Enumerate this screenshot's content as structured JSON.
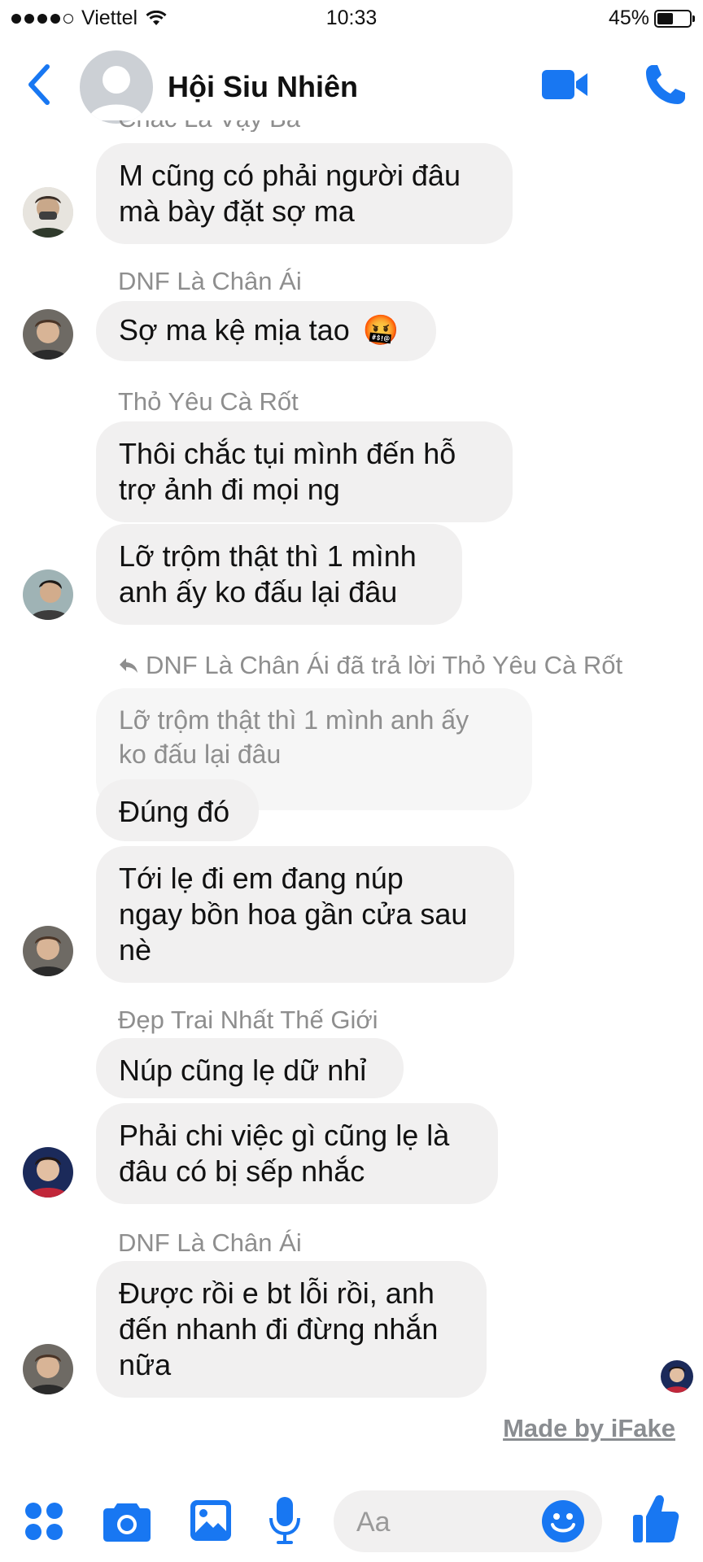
{
  "status": {
    "carrier": "Viettel",
    "time": "10:33",
    "battery": "45%",
    "battery_level": 0.45
  },
  "header": {
    "title": "Hội Siu Nhiên"
  },
  "conversation": {
    "cut_off_name": "Chắc Là Vậy Ba",
    "msg1": {
      "lines": [
        "M cũng có phải người đâu",
        "mà bày đặt sợ ma"
      ]
    },
    "group2": {
      "sender": "DNF Là Chân Ái",
      "text": "Sợ ma kệ mịa tao",
      "emoji": "🤬"
    },
    "group3": {
      "sender": "Thỏ Yêu Cà Rốt",
      "msg_a": [
        "Thôi chắc tụi mình đến hỗ",
        "trợ ảnh đi mọi ng"
      ],
      "msg_b": [
        "Lỡ trộm thật thì 1 mình",
        "anh ấy ko đấu lại đâu"
      ]
    },
    "reply": {
      "line": "DNF Là Chân Ái đã trả lời Thỏ Yêu Cà Rốt",
      "quoted": [
        "Lỡ trộm thật thì 1 mình anh ấy",
        "ko đấu lại đâu"
      ],
      "text": "Đúng đó",
      "next": [
        "Tới lẹ đi em đang núp",
        "ngay bồn hoa gần cửa sau",
        "nè"
      ]
    },
    "group5": {
      "sender": "Đẹp Trai Nhất Thế Giới",
      "msg_a": "Núp cũng lẹ dữ nhỉ",
      "msg_b": [
        "Phải chi việc gì cũng lẹ là",
        "đâu có bị sếp nhắc"
      ]
    },
    "group6": {
      "sender": "DNF Là Chân Ái",
      "msg": [
        "Được rồi e bt lỗi rồi, anh",
        "đến nhanh đi đừng nhắn",
        "nữa"
      ]
    }
  },
  "watermark": "Made by iFake",
  "composer": {
    "placeholder": "Aa"
  },
  "colors": {
    "accent": "#1877f2",
    "bubble": "#f1f0f0",
    "secondary_text": "#8e8e8e"
  }
}
